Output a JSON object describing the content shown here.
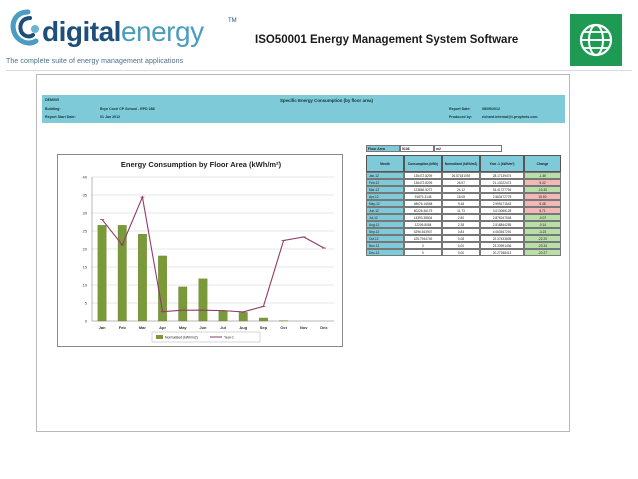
{
  "header": {
    "logo_main": "digital",
    "logo_accent": "energy",
    "logo_tm": "TM",
    "tagline": "The complete suite of energy management applications",
    "title": "ISO50001 Energy Management System Software",
    "globe_icon": "globe-icon",
    "accent_green": "#1e9a55"
  },
  "report": {
    "code": "DEM005",
    "title": "Specific Energy Consumption (by floor area)",
    "building_label": "Building:",
    "building_value": "Bryn Coch CP School - EPD 288",
    "start_label": "Report Start Date:",
    "start_value": "01 Jan 2012",
    "report_date_label": "Report Date:",
    "report_date_value": "08/09/2012",
    "produced_label": "Produced by:",
    "produced_value": "richard.internal@i-prophets.com",
    "floor_area_label": "Floor Area",
    "floor_area_value": "5136",
    "floor_area_unit": "m2"
  },
  "chart_data": {
    "type": "bar",
    "title": "Energy Consumption by Floor Area (kWh/m²)",
    "categories": [
      "Jan",
      "Feb",
      "Mar",
      "Apr",
      "May",
      "Jun",
      "Jul",
      "Aug",
      "Sep",
      "Oct",
      "Nov",
      "Dec"
    ],
    "series": [
      {
        "name": "Normalised (kWh/m2)",
        "kind": "bar",
        "color": "#7a9a3a",
        "values": [
          26.57,
          26.57,
          24.12,
          18.08,
          9.48,
          11.73,
          2.8,
          2.38,
          0.84,
          0.08,
          0,
          0
        ]
      },
      {
        "name": "Year-1",
        "kind": "line",
        "color": "#8e3b6e",
        "values": [
          28.17,
          21.13,
          34.42,
          2.58,
          3.0,
          3.01,
          2.88,
          2.52,
          4.06,
          22.37,
          23.34,
          20.27
        ]
      }
    ],
    "ylim": [
      0,
      40
    ],
    "yticks": [
      0,
      5,
      10,
      15,
      20,
      25,
      30,
      35,
      40
    ],
    "grid": true,
    "legend": "bottom"
  },
  "table": {
    "headers": [
      "Month",
      "Consumption (kWh)",
      "Normalised (kWh/m2)",
      "Year -1 (kWh/m²)",
      "Change"
    ],
    "rows": [
      {
        "month": "Jan-12",
        "consumption": "136472.8209",
        "normalised": "26.57181092",
        "year1": "28.17139474",
        "change": "-1.60",
        "trend": "down"
      },
      {
        "month": "Feb-12",
        "consumption": "136472.8209",
        "normalised": "26.57",
        "year1": "21.13222474",
        "change": "5.42",
        "trend": "up"
      },
      {
        "month": "Mar-12",
        "consumption": "123866.5272",
        "normalised": "24.12",
        "year1": "34.41727794",
        "change": "-10.30",
        "trend": "down"
      },
      {
        "month": "Apr-12",
        "consumption": "91875.3148",
        "normalised": "18.08",
        "year1": "2.583472778",
        "change": "15.50",
        "trend": "up"
      },
      {
        "month": "May-12",
        "consumption": "48676.16548",
        "normalised": "9.48",
        "year1": "2.995171543",
        "change": "6.48",
        "trend": "up"
      },
      {
        "month": "Jun-12",
        "consumption": "60226.36175",
        "normalised": "11.73",
        "year1": "3.013068128",
        "change": "8.71",
        "trend": "up"
      },
      {
        "month": "Jul-12",
        "consumption": "14393.38504",
        "normalised": "2.80",
        "year1": "2.876247548",
        "change": "-0.07",
        "trend": "down"
      },
      {
        "month": "Aug-12",
        "consumption": "12206.8084",
        "normalised": "2.38",
        "year1": "2.518844255",
        "change": "-0.14",
        "trend": "down"
      },
      {
        "month": "Sep-12",
        "consumption": "4296.543907",
        "normalised": "0.84",
        "year1": "4.063547291",
        "change": "-3.23",
        "trend": "down"
      },
      {
        "month": "Oct-12",
        "consumption": "425.7944749",
        "normalised": "0.08",
        "year1": "22.37433835",
        "change": "-22.29",
        "trend": "down"
      },
      {
        "month": "Nov-12",
        "consumption": "0",
        "normalised": "0.00",
        "year1": "23.33991436",
        "change": "-23.34",
        "trend": "down"
      },
      {
        "month": "Dec-12",
        "consumption": "0",
        "normalised": "0.00",
        "year1": "20.27288413",
        "change": "-20.27",
        "trend": "down"
      }
    ]
  },
  "colors": {
    "report_header_bg": "#7fcad8",
    "change_up_bg": "#f2b8b8",
    "change_down_bg": "#b9dfa8"
  }
}
